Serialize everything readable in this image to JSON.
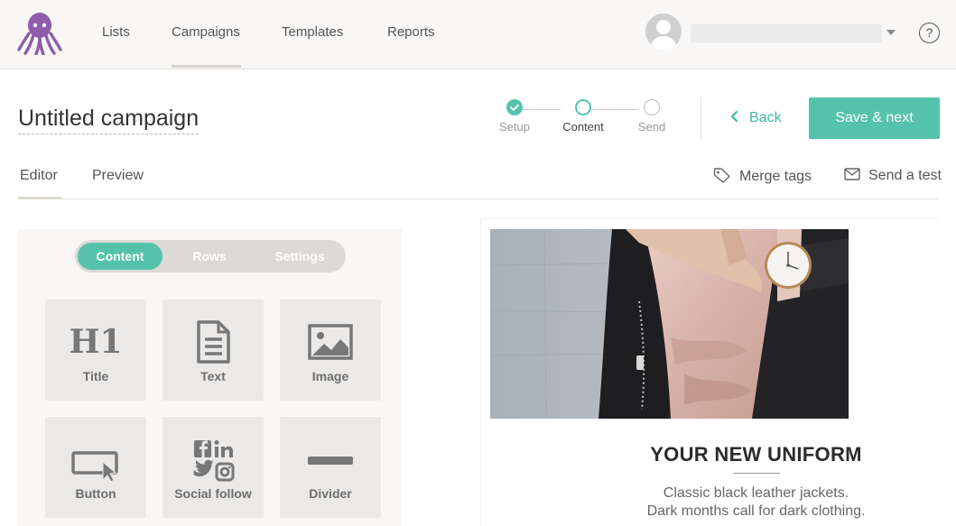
{
  "nav": {
    "items": [
      {
        "label": "Lists"
      },
      {
        "label": "Campaigns",
        "active": true
      },
      {
        "label": "Templates"
      },
      {
        "label": "Reports"
      }
    ],
    "help_label": "?",
    "logo_icon": "octopus-logo-icon",
    "brand_color": "#8e5ca8"
  },
  "campaign": {
    "title": "Untitled campaign"
  },
  "stepper": {
    "steps": [
      {
        "label": "Setup",
        "state": "done"
      },
      {
        "label": "Content",
        "state": "current"
      },
      {
        "label": "Send",
        "state": "pending"
      }
    ],
    "accent_color": "#55c3ac"
  },
  "actions": {
    "back_label": "Back",
    "save_label": "Save & next"
  },
  "tabs": {
    "editor_label": "Editor",
    "preview_label": "Preview",
    "merge_tags_label": "Merge tags",
    "send_test_label": "Send a test"
  },
  "panel": {
    "segments": [
      {
        "label": "Content",
        "active": true
      },
      {
        "label": "Rows"
      },
      {
        "label": "Settings"
      }
    ],
    "blocks": [
      {
        "label": "Title",
        "icon": "h1-icon"
      },
      {
        "label": "Text",
        "icon": "document-icon"
      },
      {
        "label": "Image",
        "icon": "image-icon"
      },
      {
        "label": "Button",
        "icon": "button-icon"
      },
      {
        "label": "Social follow",
        "icon": "social-icons"
      },
      {
        "label": "Divider",
        "icon": "divider-icon"
      }
    ],
    "h1_glyph": "H1"
  },
  "email_preview": {
    "heading": "YOUR NEW UNIFORM",
    "body_line1": "Classic black leather jackets.",
    "body_line2": "Dark months call for dark clothing."
  }
}
